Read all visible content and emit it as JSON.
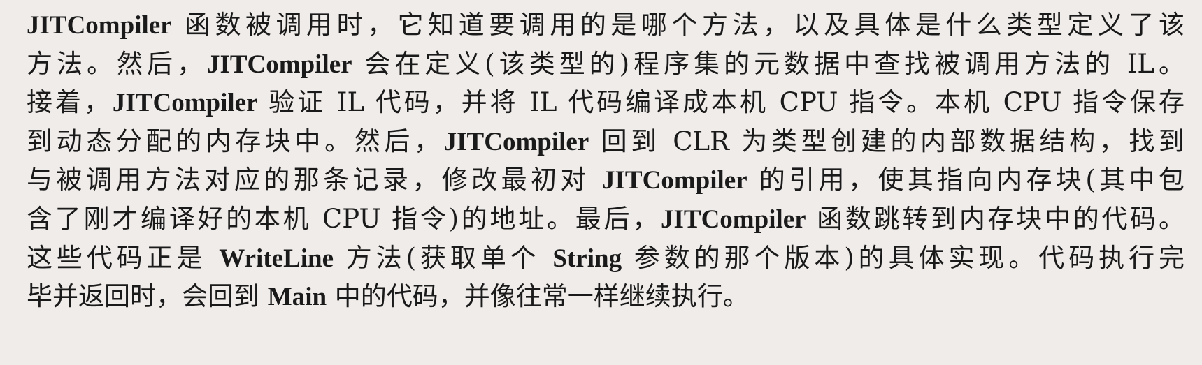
{
  "document": {
    "lines": [
      [
        {
          "text": "JITCompiler",
          "bold": true
        },
        {
          "text": " 函数被调用时，它知道要调用的是哪个方法，以及具体是什么类型定义了该",
          "bold": false
        }
      ],
      [
        {
          "text": "方法。然后，",
          "bold": false
        },
        {
          "text": "JITCompiler",
          "bold": true
        },
        {
          "text": " 会在定义(该类型的)程序集的元数据中查找被调用方法的 IL。",
          "bold": false
        }
      ],
      [
        {
          "text": "接着，",
          "bold": false
        },
        {
          "text": "JITCompiler",
          "bold": true
        },
        {
          "text": " 验证 IL 代码，并将 IL 代码编译成本机 CPU 指令。本机 CPU 指令保存",
          "bold": false
        }
      ],
      [
        {
          "text": "到动态分配的内存块中。然后，",
          "bold": false
        },
        {
          "text": "JITCompiler",
          "bold": true
        },
        {
          "text": " 回到 CLR 为类型创建的内部数据结构，找到",
          "bold": false
        }
      ],
      [
        {
          "text": "与被调用方法对应的那条记录，修改最初对 ",
          "bold": false
        },
        {
          "text": "JITCompiler",
          "bold": true
        },
        {
          "text": " 的引用，使其指向内存块(其中包",
          "bold": false
        }
      ],
      [
        {
          "text": "含了刚才编译好的本机 CPU 指令)的地址。最后，",
          "bold": false
        },
        {
          "text": "JITCompiler",
          "bold": true
        },
        {
          "text": " 函数跳转到内存块中的代码。",
          "bold": false
        }
      ],
      [
        {
          "text": "这些代码正是 ",
          "bold": false
        },
        {
          "text": "WriteLine",
          "bold": true
        },
        {
          "text": " 方法(获取单个 ",
          "bold": false
        },
        {
          "text": "String",
          "bold": true
        },
        {
          "text": " 参数的那个版本)的具体实现。代码执行完",
          "bold": false
        }
      ],
      [
        {
          "text": "毕并返回时，会回到 ",
          "bold": false
        },
        {
          "text": "Main",
          "bold": true
        },
        {
          "text": " 中的代码，并像往常一样继续执行。",
          "bold": false
        }
      ]
    ]
  }
}
